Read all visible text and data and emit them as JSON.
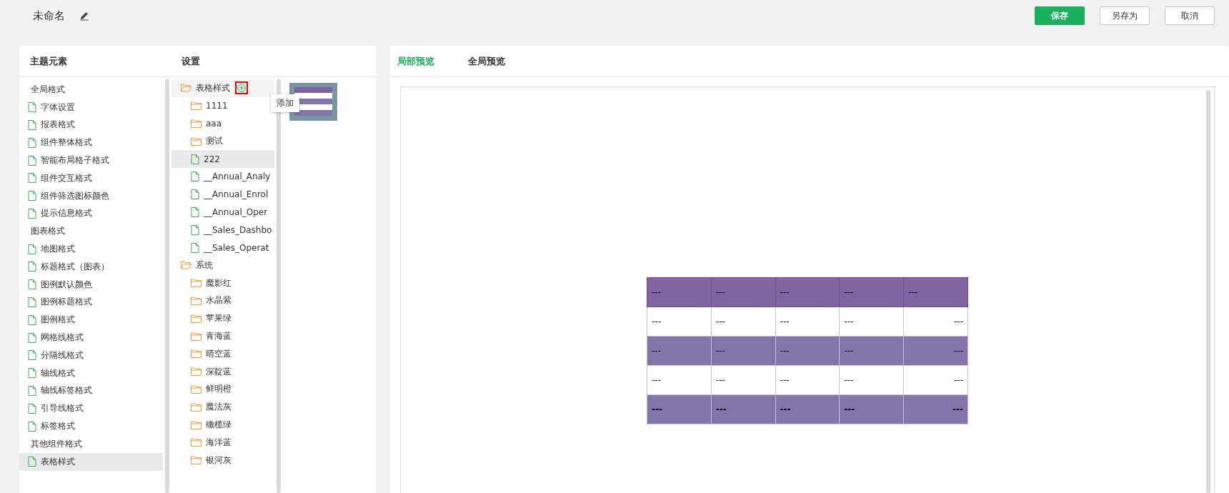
{
  "header": {
    "title": "未命名",
    "buttons": [
      {
        "label": "保存",
        "kind": "primary"
      },
      {
        "label": "另存为",
        "kind": "default"
      },
      {
        "label": "取消",
        "kind": "default"
      }
    ]
  },
  "left_panel": {
    "columns": [
      "主题元素",
      "设置"
    ],
    "elements": [
      {
        "kind": "group",
        "label": "全局格式",
        "selected": false
      },
      {
        "kind": "item",
        "label": "字体设置",
        "selected": false
      },
      {
        "kind": "item",
        "label": "报表格式",
        "selected": false
      },
      {
        "kind": "item",
        "label": "组件整体格式",
        "selected": false
      },
      {
        "kind": "item",
        "label": "智能布局格子格式",
        "selected": false
      },
      {
        "kind": "item",
        "label": "组件交互格式",
        "selected": false
      },
      {
        "kind": "item",
        "label": "组件筛选图标颜色",
        "selected": false
      },
      {
        "kind": "item",
        "label": "提示信息格式",
        "selected": false
      },
      {
        "kind": "group",
        "label": "图表格式",
        "selected": false
      },
      {
        "kind": "item",
        "label": "地图格式",
        "selected": false
      },
      {
        "kind": "item",
        "label": "标题格式（图表）",
        "selected": false
      },
      {
        "kind": "item",
        "label": "图例默认颜色",
        "selected": false
      },
      {
        "kind": "item",
        "label": "图例标题格式",
        "selected": false
      },
      {
        "kind": "item",
        "label": "图例格式",
        "selected": false
      },
      {
        "kind": "item",
        "label": "网格线格式",
        "selected": false
      },
      {
        "kind": "item",
        "label": "分隔线格式",
        "selected": false
      },
      {
        "kind": "item",
        "label": "轴线格式",
        "selected": false
      },
      {
        "kind": "item",
        "label": "轴线标签格式",
        "selected": false
      },
      {
        "kind": "item",
        "label": "引导线格式",
        "selected": false
      },
      {
        "kind": "item",
        "label": "标签格式",
        "selected": false
      },
      {
        "kind": "group",
        "label": "其他组件格式",
        "selected": false
      },
      {
        "kind": "item",
        "label": "表格样式",
        "selected": true
      }
    ],
    "tree": [
      {
        "kind": "folder",
        "label": "表格样式",
        "hovered": true,
        "add_tooltip": "添加",
        "children": [
          {
            "kind": "folder",
            "label": "1111",
            "selected": false
          },
          {
            "kind": "folder",
            "label": "aaa",
            "selected": false
          },
          {
            "kind": "folder",
            "label": "测试",
            "selected": false
          },
          {
            "kind": "doc",
            "label": "222",
            "selected": true
          },
          {
            "kind": "doc",
            "label": "__Annual_Analy",
            "selected": false
          },
          {
            "kind": "doc",
            "label": "__Annual_Enrol",
            "selected": false
          },
          {
            "kind": "doc",
            "label": "__Annual_Oper",
            "selected": false
          },
          {
            "kind": "doc",
            "label": "__Sales_Dashbo",
            "selected": false
          },
          {
            "kind": "doc",
            "label": "__Sales_Operat",
            "selected": false
          }
        ]
      },
      {
        "kind": "folder",
        "label": "系统",
        "hovered": false,
        "children": [
          {
            "kind": "folder",
            "label": "魔影红",
            "selected": false
          },
          {
            "kind": "folder",
            "label": "水晶紫",
            "selected": false
          },
          {
            "kind": "folder",
            "label": "苹果绿",
            "selected": false
          },
          {
            "kind": "folder",
            "label": "青海蓝",
            "selected": false
          },
          {
            "kind": "folder",
            "label": "晴空蓝",
            "selected": false
          },
          {
            "kind": "folder",
            "label": "深靛蓝",
            "selected": false
          },
          {
            "kind": "folder",
            "label": "鲜明橙",
            "selected": false
          },
          {
            "kind": "folder",
            "label": "魔法灰",
            "selected": false
          },
          {
            "kind": "folder",
            "label": "橄榄绿",
            "selected": false
          },
          {
            "kind": "folder",
            "label": "海洋蓝",
            "selected": false
          },
          {
            "kind": "folder",
            "label": "银河灰",
            "selected": false
          }
        ]
      }
    ]
  },
  "preview": {
    "tabs": [
      {
        "label": "局部预览",
        "selected": true
      },
      {
        "label": "全局预览",
        "selected": false
      }
    ],
    "table": {
      "rows": [
        {
          "kind": "header",
          "cells": [
            "---",
            "---",
            "---",
            "---",
            "---"
          ]
        },
        {
          "kind": "plain",
          "cells": [
            "---",
            "---",
            "---",
            "---",
            "---"
          ]
        },
        {
          "kind": "band",
          "cells": [
            "---",
            "---",
            "---",
            "---",
            "---"
          ]
        },
        {
          "kind": "plain",
          "cells": [
            "---",
            "---",
            "---",
            "---",
            "---"
          ]
        },
        {
          "kind": "footer",
          "cells": [
            "---",
            "---",
            "---",
            "---",
            "---"
          ]
        }
      ]
    }
  }
}
